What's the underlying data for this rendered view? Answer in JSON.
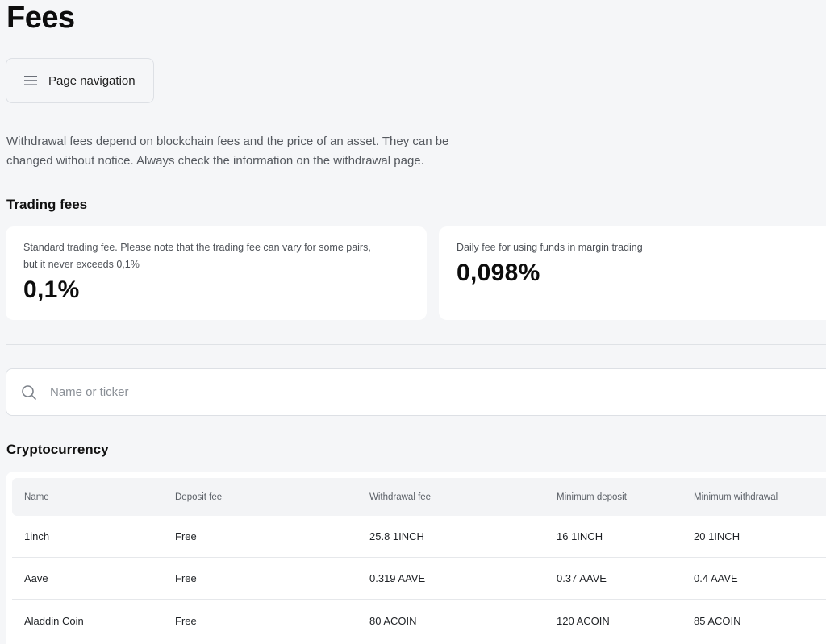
{
  "page": {
    "title": "Fees"
  },
  "page_nav": {
    "label": "Page navigation",
    "icon": "menu-icon"
  },
  "intro": {
    "line1": "Withdrawal fees depend on blockchain fees and the price of an asset. They can be",
    "line2": "changed without notice. Always check the information on the withdrawal page."
  },
  "trading_fees": {
    "title": "Trading fees",
    "cards": [
      {
        "desc1": "Standard trading fee. Please note that the trading fee can vary for some pairs,",
        "desc2": "but it never exceeds 0,1%",
        "value": "0,1%"
      },
      {
        "desc1": "Daily fee for using funds in margin trading",
        "value": "0,098%"
      }
    ]
  },
  "search": {
    "placeholder": "Name or ticker",
    "value": "",
    "icon": "search-icon"
  },
  "crypto": {
    "title": "Cryptocurrency",
    "columns": [
      "Name",
      "Deposit fee",
      "Withdrawal fee",
      "Minimum deposit",
      "Minimum withdrawal"
    ],
    "rows": [
      [
        "1inch",
        "Free",
        "25.8 1INCH",
        "16 1INCH",
        "20 1INCH"
      ],
      [
        "Aave",
        "Free",
        "0.319 AAVE",
        "0.37 AAVE",
        "0.4 AAVE"
      ],
      [
        "Aladdin Coin",
        "Free",
        "80 ACOIN",
        "120 ACOIN",
        "85 ACOIN"
      ]
    ]
  },
  "colors": {
    "background": "#f5f6f8",
    "card": "#ffffff",
    "text": "#0d0d0d",
    "muted": "#55595f"
  }
}
